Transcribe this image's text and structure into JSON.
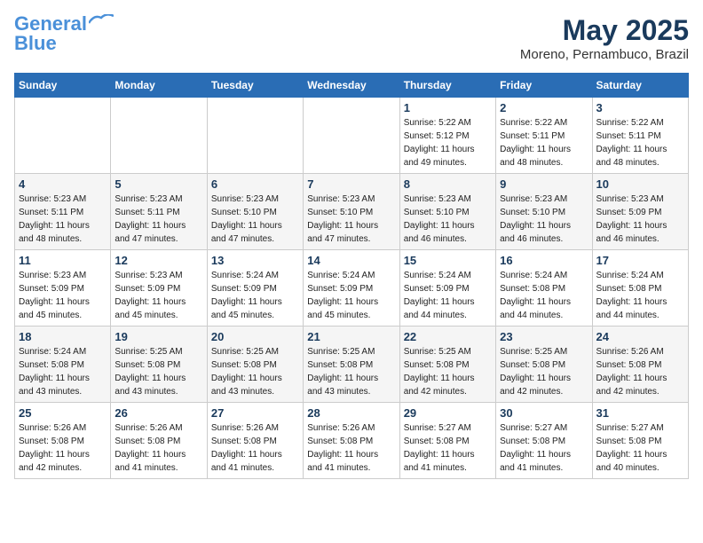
{
  "header": {
    "logo_line1": "General",
    "logo_line2": "Blue",
    "month_year": "May 2025",
    "location": "Moreno, Pernambuco, Brazil"
  },
  "weekdays": [
    "Sunday",
    "Monday",
    "Tuesday",
    "Wednesday",
    "Thursday",
    "Friday",
    "Saturday"
  ],
  "weeks": [
    [
      {
        "day": "",
        "info": ""
      },
      {
        "day": "",
        "info": ""
      },
      {
        "day": "",
        "info": ""
      },
      {
        "day": "",
        "info": ""
      },
      {
        "day": "1",
        "info": "Sunrise: 5:22 AM\nSunset: 5:12 PM\nDaylight: 11 hours\nand 49 minutes."
      },
      {
        "day": "2",
        "info": "Sunrise: 5:22 AM\nSunset: 5:11 PM\nDaylight: 11 hours\nand 48 minutes."
      },
      {
        "day": "3",
        "info": "Sunrise: 5:22 AM\nSunset: 5:11 PM\nDaylight: 11 hours\nand 48 minutes."
      }
    ],
    [
      {
        "day": "4",
        "info": "Sunrise: 5:23 AM\nSunset: 5:11 PM\nDaylight: 11 hours\nand 48 minutes."
      },
      {
        "day": "5",
        "info": "Sunrise: 5:23 AM\nSunset: 5:11 PM\nDaylight: 11 hours\nand 47 minutes."
      },
      {
        "day": "6",
        "info": "Sunrise: 5:23 AM\nSunset: 5:10 PM\nDaylight: 11 hours\nand 47 minutes."
      },
      {
        "day": "7",
        "info": "Sunrise: 5:23 AM\nSunset: 5:10 PM\nDaylight: 11 hours\nand 47 minutes."
      },
      {
        "day": "8",
        "info": "Sunrise: 5:23 AM\nSunset: 5:10 PM\nDaylight: 11 hours\nand 46 minutes."
      },
      {
        "day": "9",
        "info": "Sunrise: 5:23 AM\nSunset: 5:10 PM\nDaylight: 11 hours\nand 46 minutes."
      },
      {
        "day": "10",
        "info": "Sunrise: 5:23 AM\nSunset: 5:09 PM\nDaylight: 11 hours\nand 46 minutes."
      }
    ],
    [
      {
        "day": "11",
        "info": "Sunrise: 5:23 AM\nSunset: 5:09 PM\nDaylight: 11 hours\nand 45 minutes."
      },
      {
        "day": "12",
        "info": "Sunrise: 5:23 AM\nSunset: 5:09 PM\nDaylight: 11 hours\nand 45 minutes."
      },
      {
        "day": "13",
        "info": "Sunrise: 5:24 AM\nSunset: 5:09 PM\nDaylight: 11 hours\nand 45 minutes."
      },
      {
        "day": "14",
        "info": "Sunrise: 5:24 AM\nSunset: 5:09 PM\nDaylight: 11 hours\nand 45 minutes."
      },
      {
        "day": "15",
        "info": "Sunrise: 5:24 AM\nSunset: 5:09 PM\nDaylight: 11 hours\nand 44 minutes."
      },
      {
        "day": "16",
        "info": "Sunrise: 5:24 AM\nSunset: 5:08 PM\nDaylight: 11 hours\nand 44 minutes."
      },
      {
        "day": "17",
        "info": "Sunrise: 5:24 AM\nSunset: 5:08 PM\nDaylight: 11 hours\nand 44 minutes."
      }
    ],
    [
      {
        "day": "18",
        "info": "Sunrise: 5:24 AM\nSunset: 5:08 PM\nDaylight: 11 hours\nand 43 minutes."
      },
      {
        "day": "19",
        "info": "Sunrise: 5:25 AM\nSunset: 5:08 PM\nDaylight: 11 hours\nand 43 minutes."
      },
      {
        "day": "20",
        "info": "Sunrise: 5:25 AM\nSunset: 5:08 PM\nDaylight: 11 hours\nand 43 minutes."
      },
      {
        "day": "21",
        "info": "Sunrise: 5:25 AM\nSunset: 5:08 PM\nDaylight: 11 hours\nand 43 minutes."
      },
      {
        "day": "22",
        "info": "Sunrise: 5:25 AM\nSunset: 5:08 PM\nDaylight: 11 hours\nand 42 minutes."
      },
      {
        "day": "23",
        "info": "Sunrise: 5:25 AM\nSunset: 5:08 PM\nDaylight: 11 hours\nand 42 minutes."
      },
      {
        "day": "24",
        "info": "Sunrise: 5:26 AM\nSunset: 5:08 PM\nDaylight: 11 hours\nand 42 minutes."
      }
    ],
    [
      {
        "day": "25",
        "info": "Sunrise: 5:26 AM\nSunset: 5:08 PM\nDaylight: 11 hours\nand 42 minutes."
      },
      {
        "day": "26",
        "info": "Sunrise: 5:26 AM\nSunset: 5:08 PM\nDaylight: 11 hours\nand 41 minutes."
      },
      {
        "day": "27",
        "info": "Sunrise: 5:26 AM\nSunset: 5:08 PM\nDaylight: 11 hours\nand 41 minutes."
      },
      {
        "day": "28",
        "info": "Sunrise: 5:26 AM\nSunset: 5:08 PM\nDaylight: 11 hours\nand 41 minutes."
      },
      {
        "day": "29",
        "info": "Sunrise: 5:27 AM\nSunset: 5:08 PM\nDaylight: 11 hours\nand 41 minutes."
      },
      {
        "day": "30",
        "info": "Sunrise: 5:27 AM\nSunset: 5:08 PM\nDaylight: 11 hours\nand 41 minutes."
      },
      {
        "day": "31",
        "info": "Sunrise: 5:27 AM\nSunset: 5:08 PM\nDaylight: 11 hours\nand 40 minutes."
      }
    ]
  ]
}
